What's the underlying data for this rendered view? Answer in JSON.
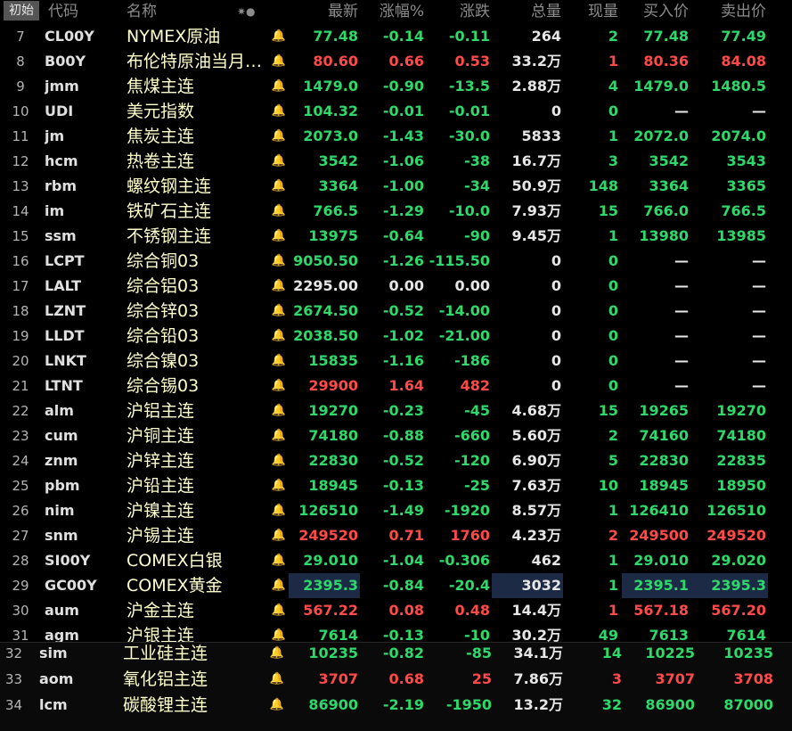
{
  "header": {
    "tag": "初始",
    "code": "代码",
    "name": "名称",
    "alert": "✷●",
    "last": "最新",
    "pct": "涨幅%",
    "chg": "涨跌",
    "vol": "总量",
    "cur": "现量",
    "bid": "买入价",
    "ask": "卖出价"
  },
  "colors": {
    "up": "#ff4a4a",
    "down": "#2ed86a",
    "name": "#ffffcc",
    "highlight": "#1c2a46",
    "bell_active": "#ff5a28"
  },
  "rows": [
    {
      "n": "7",
      "code": "CL00Y",
      "name": "NYMEX原油",
      "bell": false,
      "last": "77.48",
      "pct": "-0.14",
      "chg": "-0.11",
      "vol": "264",
      "cur": "2",
      "bid": "77.48",
      "ask": "77.49"
    },
    {
      "n": "8",
      "code": "B00Y",
      "name": "布伦特原油当月…",
      "bell": false,
      "last": "80.60",
      "pct": "0.66",
      "chg": "0.53",
      "vol": "33.2万",
      "cur": "1",
      "bid": "80.36",
      "ask": "84.08"
    },
    {
      "n": "9",
      "code": "jmm",
      "name": "焦煤主连",
      "bell": false,
      "last": "1479.0",
      "pct": "-0.90",
      "chg": "-13.5",
      "vol": "2.88万",
      "cur": "4",
      "bid": "1479.0",
      "ask": "1480.5"
    },
    {
      "n": "10",
      "code": "UDI",
      "name": "美元指数",
      "bell": false,
      "last": "104.32",
      "pct": "-0.01",
      "chg": "-0.01",
      "vol": "0",
      "cur": "0",
      "bid": "—",
      "ask": "—"
    },
    {
      "n": "11",
      "code": "jm",
      "name": "焦炭主连",
      "bell": false,
      "last": "2073.0",
      "pct": "-1.43",
      "chg": "-30.0",
      "vol": "5833",
      "cur": "1",
      "bid": "2072.0",
      "ask": "2074.0"
    },
    {
      "n": "12",
      "code": "hcm",
      "name": "热卷主连",
      "bell": false,
      "last": "3542",
      "pct": "-1.06",
      "chg": "-38",
      "vol": "16.7万",
      "cur": "3",
      "bid": "3542",
      "ask": "3543"
    },
    {
      "n": "13",
      "code": "rbm",
      "name": "螺纹钢主连",
      "bell": false,
      "last": "3364",
      "pct": "-1.00",
      "chg": "-34",
      "vol": "50.9万",
      "cur": "148",
      "bid": "3364",
      "ask": "3365"
    },
    {
      "n": "14",
      "code": "im",
      "name": "铁矿石主连",
      "bell": false,
      "last": "766.5",
      "pct": "-1.29",
      "chg": "-10.0",
      "vol": "7.93万",
      "cur": "15",
      "bid": "766.0",
      "ask": "766.5"
    },
    {
      "n": "15",
      "code": "ssm",
      "name": "不锈钢主连",
      "bell": false,
      "last": "13975",
      "pct": "-0.64",
      "chg": "-90",
      "vol": "9.45万",
      "cur": "1",
      "bid": "13980",
      "ask": "13985"
    },
    {
      "n": "16",
      "code": "LCPT",
      "name": "综合铜03",
      "bell": false,
      "last": "9050.50",
      "pct": "-1.26",
      "chg": "-115.50",
      "vol": "0",
      "cur": "0",
      "bid": "—",
      "ask": "—"
    },
    {
      "n": "17",
      "code": "LALT",
      "name": "综合铝03",
      "bell": false,
      "last": "2295.00",
      "pct": "0.00",
      "chg": "0.00",
      "vol": "0",
      "cur": "0",
      "bid": "—",
      "ask": "—"
    },
    {
      "n": "18",
      "code": "LZNT",
      "name": "综合锌03",
      "bell": false,
      "last": "2674.50",
      "pct": "-0.52",
      "chg": "-14.00",
      "vol": "0",
      "cur": "0",
      "bid": "—",
      "ask": "—"
    },
    {
      "n": "19",
      "code": "LLDT",
      "name": "综合铅03",
      "bell": false,
      "last": "2038.50",
      "pct": "-1.02",
      "chg": "-21.00",
      "vol": "0",
      "cur": "0",
      "bid": "—",
      "ask": "—"
    },
    {
      "n": "20",
      "code": "LNKT",
      "name": "综合镍03",
      "bell": false,
      "last": "15835",
      "pct": "-1.16",
      "chg": "-186",
      "vol": "0",
      "cur": "0",
      "bid": "—",
      "ask": "—"
    },
    {
      "n": "21",
      "code": "LTNT",
      "name": "综合锡03",
      "bell": false,
      "last": "29900",
      "pct": "1.64",
      "chg": "482",
      "vol": "0",
      "cur": "0",
      "bid": "—",
      "ask": "—"
    },
    {
      "n": "22",
      "code": "alm",
      "name": "沪铝主连",
      "bell": false,
      "last": "19270",
      "pct": "-0.23",
      "chg": "-45",
      "vol": "4.68万",
      "cur": "15",
      "bid": "19265",
      "ask": "19270"
    },
    {
      "n": "23",
      "code": "cum",
      "name": "沪铜主连",
      "bell": true,
      "last": "74180",
      "pct": "-0.88",
      "chg": "-660",
      "vol": "5.60万",
      "cur": "2",
      "bid": "74160",
      "ask": "74180"
    },
    {
      "n": "24",
      "code": "znm",
      "name": "沪锌主连",
      "bell": false,
      "last": "22830",
      "pct": "-0.52",
      "chg": "-120",
      "vol": "6.90万",
      "cur": "5",
      "bid": "22830",
      "ask": "22835"
    },
    {
      "n": "25",
      "code": "pbm",
      "name": "沪铅主连",
      "bell": false,
      "last": "18945",
      "pct": "-0.13",
      "chg": "-25",
      "vol": "7.63万",
      "cur": "10",
      "bid": "18945",
      "ask": "18950"
    },
    {
      "n": "26",
      "code": "nim",
      "name": "沪镍主连",
      "bell": false,
      "last": "126510",
      "pct": "-1.49",
      "chg": "-1920",
      "vol": "8.57万",
      "cur": "1",
      "bid": "126410",
      "ask": "126510"
    },
    {
      "n": "27",
      "code": "snm",
      "name": "沪锡主连",
      "bell": false,
      "last": "249520",
      "pct": "0.71",
      "chg": "1760",
      "vol": "4.23万",
      "cur": "2",
      "bid": "249500",
      "ask": "249520"
    },
    {
      "n": "28",
      "code": "SI00Y",
      "name": "COMEX白银",
      "bell": true,
      "last": "29.010",
      "pct": "-1.04",
      "chg": "-0.306",
      "vol": "462",
      "cur": "1",
      "bid": "29.010",
      "ask": "29.020"
    },
    {
      "n": "29",
      "code": "GC00Y",
      "name": "COMEX黄金",
      "bell": false,
      "last": "2395.3",
      "pct": "-0.84",
      "chg": "-20.4",
      "vol": "3032",
      "cur": "1",
      "bid": "2395.1",
      "ask": "2395.3"
    },
    {
      "n": "30",
      "code": "aum",
      "name": "沪金主连",
      "bell": true,
      "last": "567.22",
      "pct": "0.08",
      "chg": "0.48",
      "vol": "14.4万",
      "cur": "1",
      "bid": "567.18",
      "ask": "567.20"
    },
    {
      "n": "31",
      "code": "agm",
      "name": "沪银主连",
      "bell": false,
      "last": "7614",
      "pct": "-0.13",
      "chg": "-10",
      "vol": "30.2万",
      "cur": "49",
      "bid": "7613",
      "ask": "7614"
    }
  ],
  "rows2": [
    {
      "n": "32",
      "code": "sim",
      "name": "工业硅主连",
      "bell": false,
      "last": "10235",
      "pct": "-0.82",
      "chg": "-85",
      "vol": "34.1万",
      "cur": "14",
      "bid": "10225",
      "ask": "10235"
    },
    {
      "n": "33",
      "code": "aom",
      "name": "氧化铝主连",
      "bell": false,
      "last": "3707",
      "pct": "0.68",
      "chg": "25",
      "vol": "7.86万",
      "cur": "3",
      "bid": "3707",
      "ask": "3708"
    },
    {
      "n": "34",
      "code": "lcm",
      "name": "碳酸锂主连",
      "bell": false,
      "last": "86900",
      "pct": "-2.19",
      "chg": "-1950",
      "vol": "13.2万",
      "cur": "32",
      "bid": "86900",
      "ask": "87000"
    }
  ]
}
